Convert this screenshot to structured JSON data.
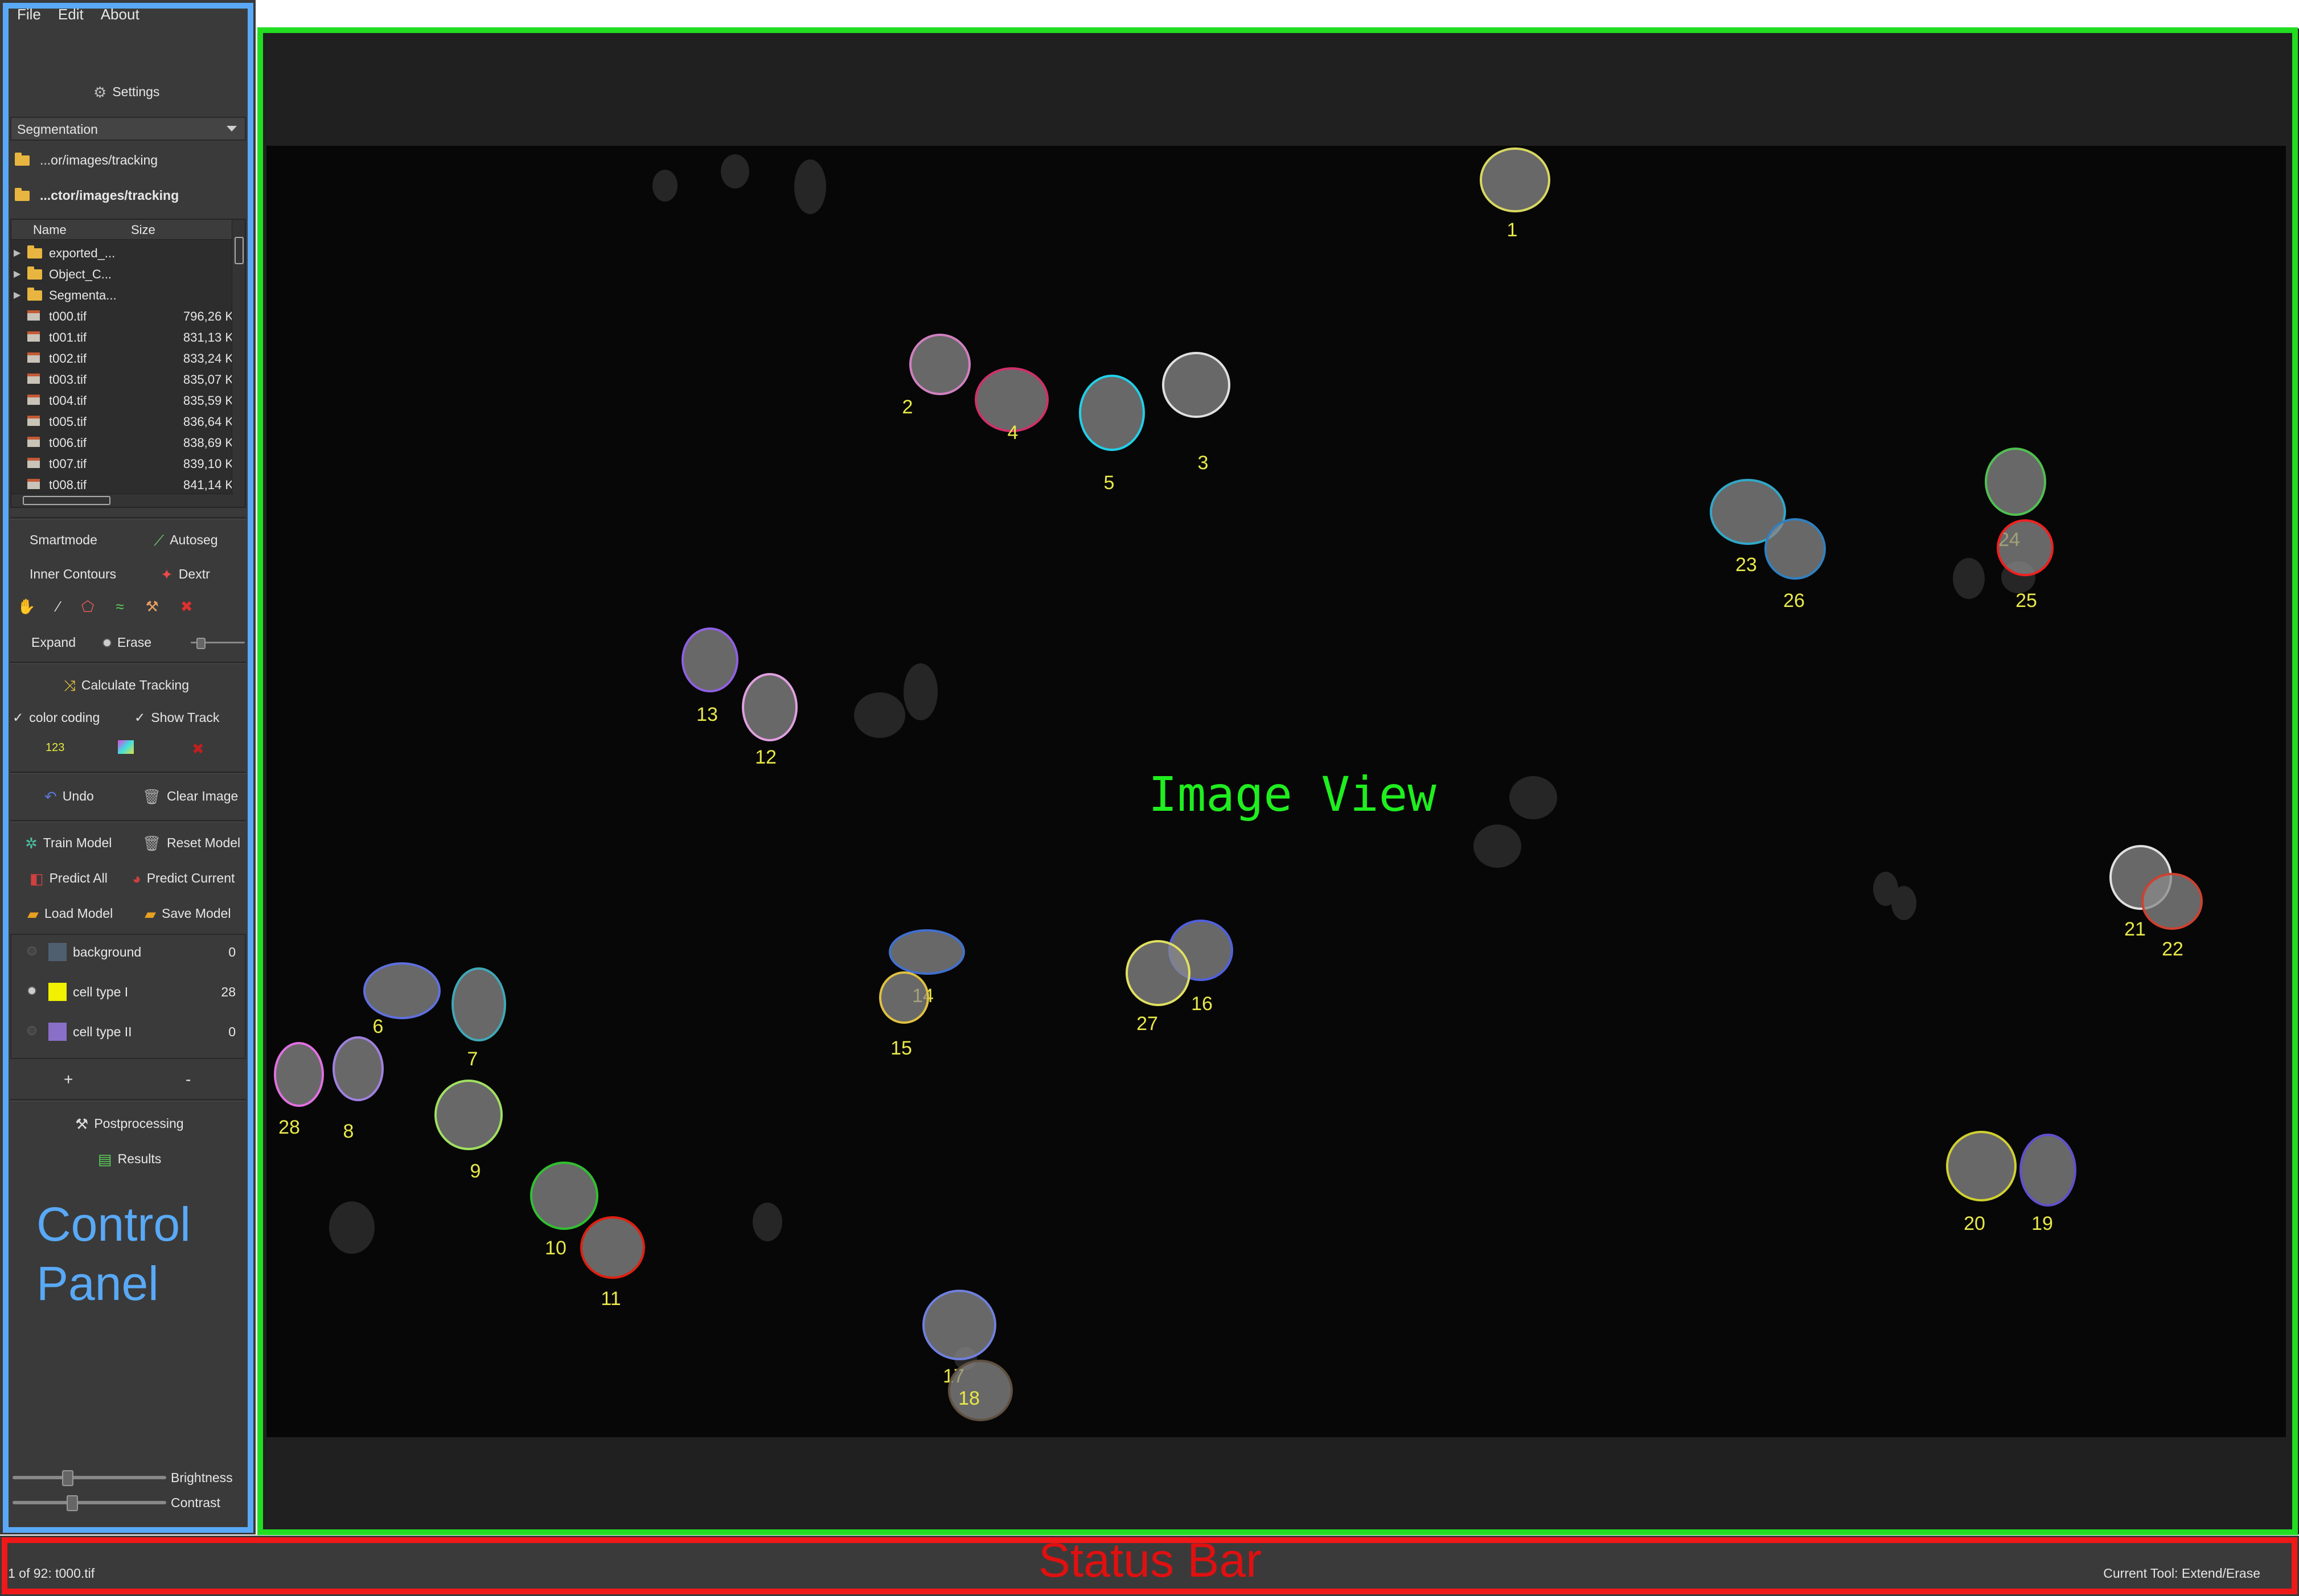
{
  "menu": [
    "File",
    "Edit",
    "About"
  ],
  "settings_label": "Settings",
  "mode_select": "Segmentation",
  "paths": {
    "input": "...or/images/tracking",
    "output": "...ctor/images/tracking"
  },
  "file_browser": {
    "headers": {
      "name": "Name",
      "size": "Size"
    },
    "folders": [
      "exported_...",
      "Object_C...",
      "Segmenta..."
    ],
    "files": [
      {
        "name": "t000.tif",
        "size": "796,26 K"
      },
      {
        "name": "t001.tif",
        "size": "831,13 K"
      },
      {
        "name": "t002.tif",
        "size": "833,24 K"
      },
      {
        "name": "t003.tif",
        "size": "835,07 K"
      },
      {
        "name": "t004.tif",
        "size": "835,59 K"
      },
      {
        "name": "t005.tif",
        "size": "836,64 K"
      },
      {
        "name": "t006.tif",
        "size": "838,69 K"
      },
      {
        "name": "t007.tif",
        "size": "839,10 K"
      },
      {
        "name": "t008.tif",
        "size": "841,14 K"
      }
    ]
  },
  "tools": {
    "smartmode": "Smartmode",
    "autoseg": "Autoseg",
    "inner_contours": "Inner Contours",
    "dextr": "Dextr",
    "expand": "Expand",
    "erase": "Erase"
  },
  "tracking": {
    "calculate": "Calculate Tracking",
    "color_coding": "color coding",
    "show_track": "Show Track",
    "number_glyph": "123"
  },
  "actions": {
    "undo": "Undo",
    "clear_image": "Clear Image",
    "train_model": "Train Model",
    "reset_model": "Reset Model",
    "predict_all": "Predict All",
    "predict_current": "Predict Current",
    "load_model": "Load Model",
    "save_model": "Save Model"
  },
  "labels": [
    {
      "name": "background",
      "count": "0",
      "color": "#4f5f70",
      "selected": false
    },
    {
      "name": "cell type I",
      "count": "28",
      "color": "#f0f000",
      "selected": true
    },
    {
      "name": "cell type II",
      "count": "0",
      "color": "#8a6fc8",
      "selected": false
    }
  ],
  "label_controls": {
    "add": "+",
    "remove": "-"
  },
  "postprocessing": "Postprocessing",
  "results": "Results",
  "sliders": {
    "brightness_label": "Brightness",
    "brightness": 0.35,
    "contrast_label": "Contrast",
    "contrast": 0.38
  },
  "annotations": {
    "control_panel": "Control Panel",
    "image_view": "Image View",
    "status_bar": "Status Bar"
  },
  "status": {
    "left": "1 of 92: t000.tif",
    "right": "Current Tool: Extend/Erase"
  },
  "cell_labels": [
    "1",
    "2",
    "3",
    "4",
    "5",
    "6",
    "7",
    "8",
    "9",
    "10",
    "11",
    "12",
    "13",
    "14",
    "15",
    "16",
    "17",
    "18",
    "19",
    "20",
    "21",
    "22",
    "23",
    "24",
    "25",
    "26",
    "27",
    "28"
  ],
  "colors": {
    "panel_outline": "#59a9f6",
    "view_outline": "#22dd22",
    "status_outline": "#f01818",
    "cell_label": "#e8e84a"
  }
}
